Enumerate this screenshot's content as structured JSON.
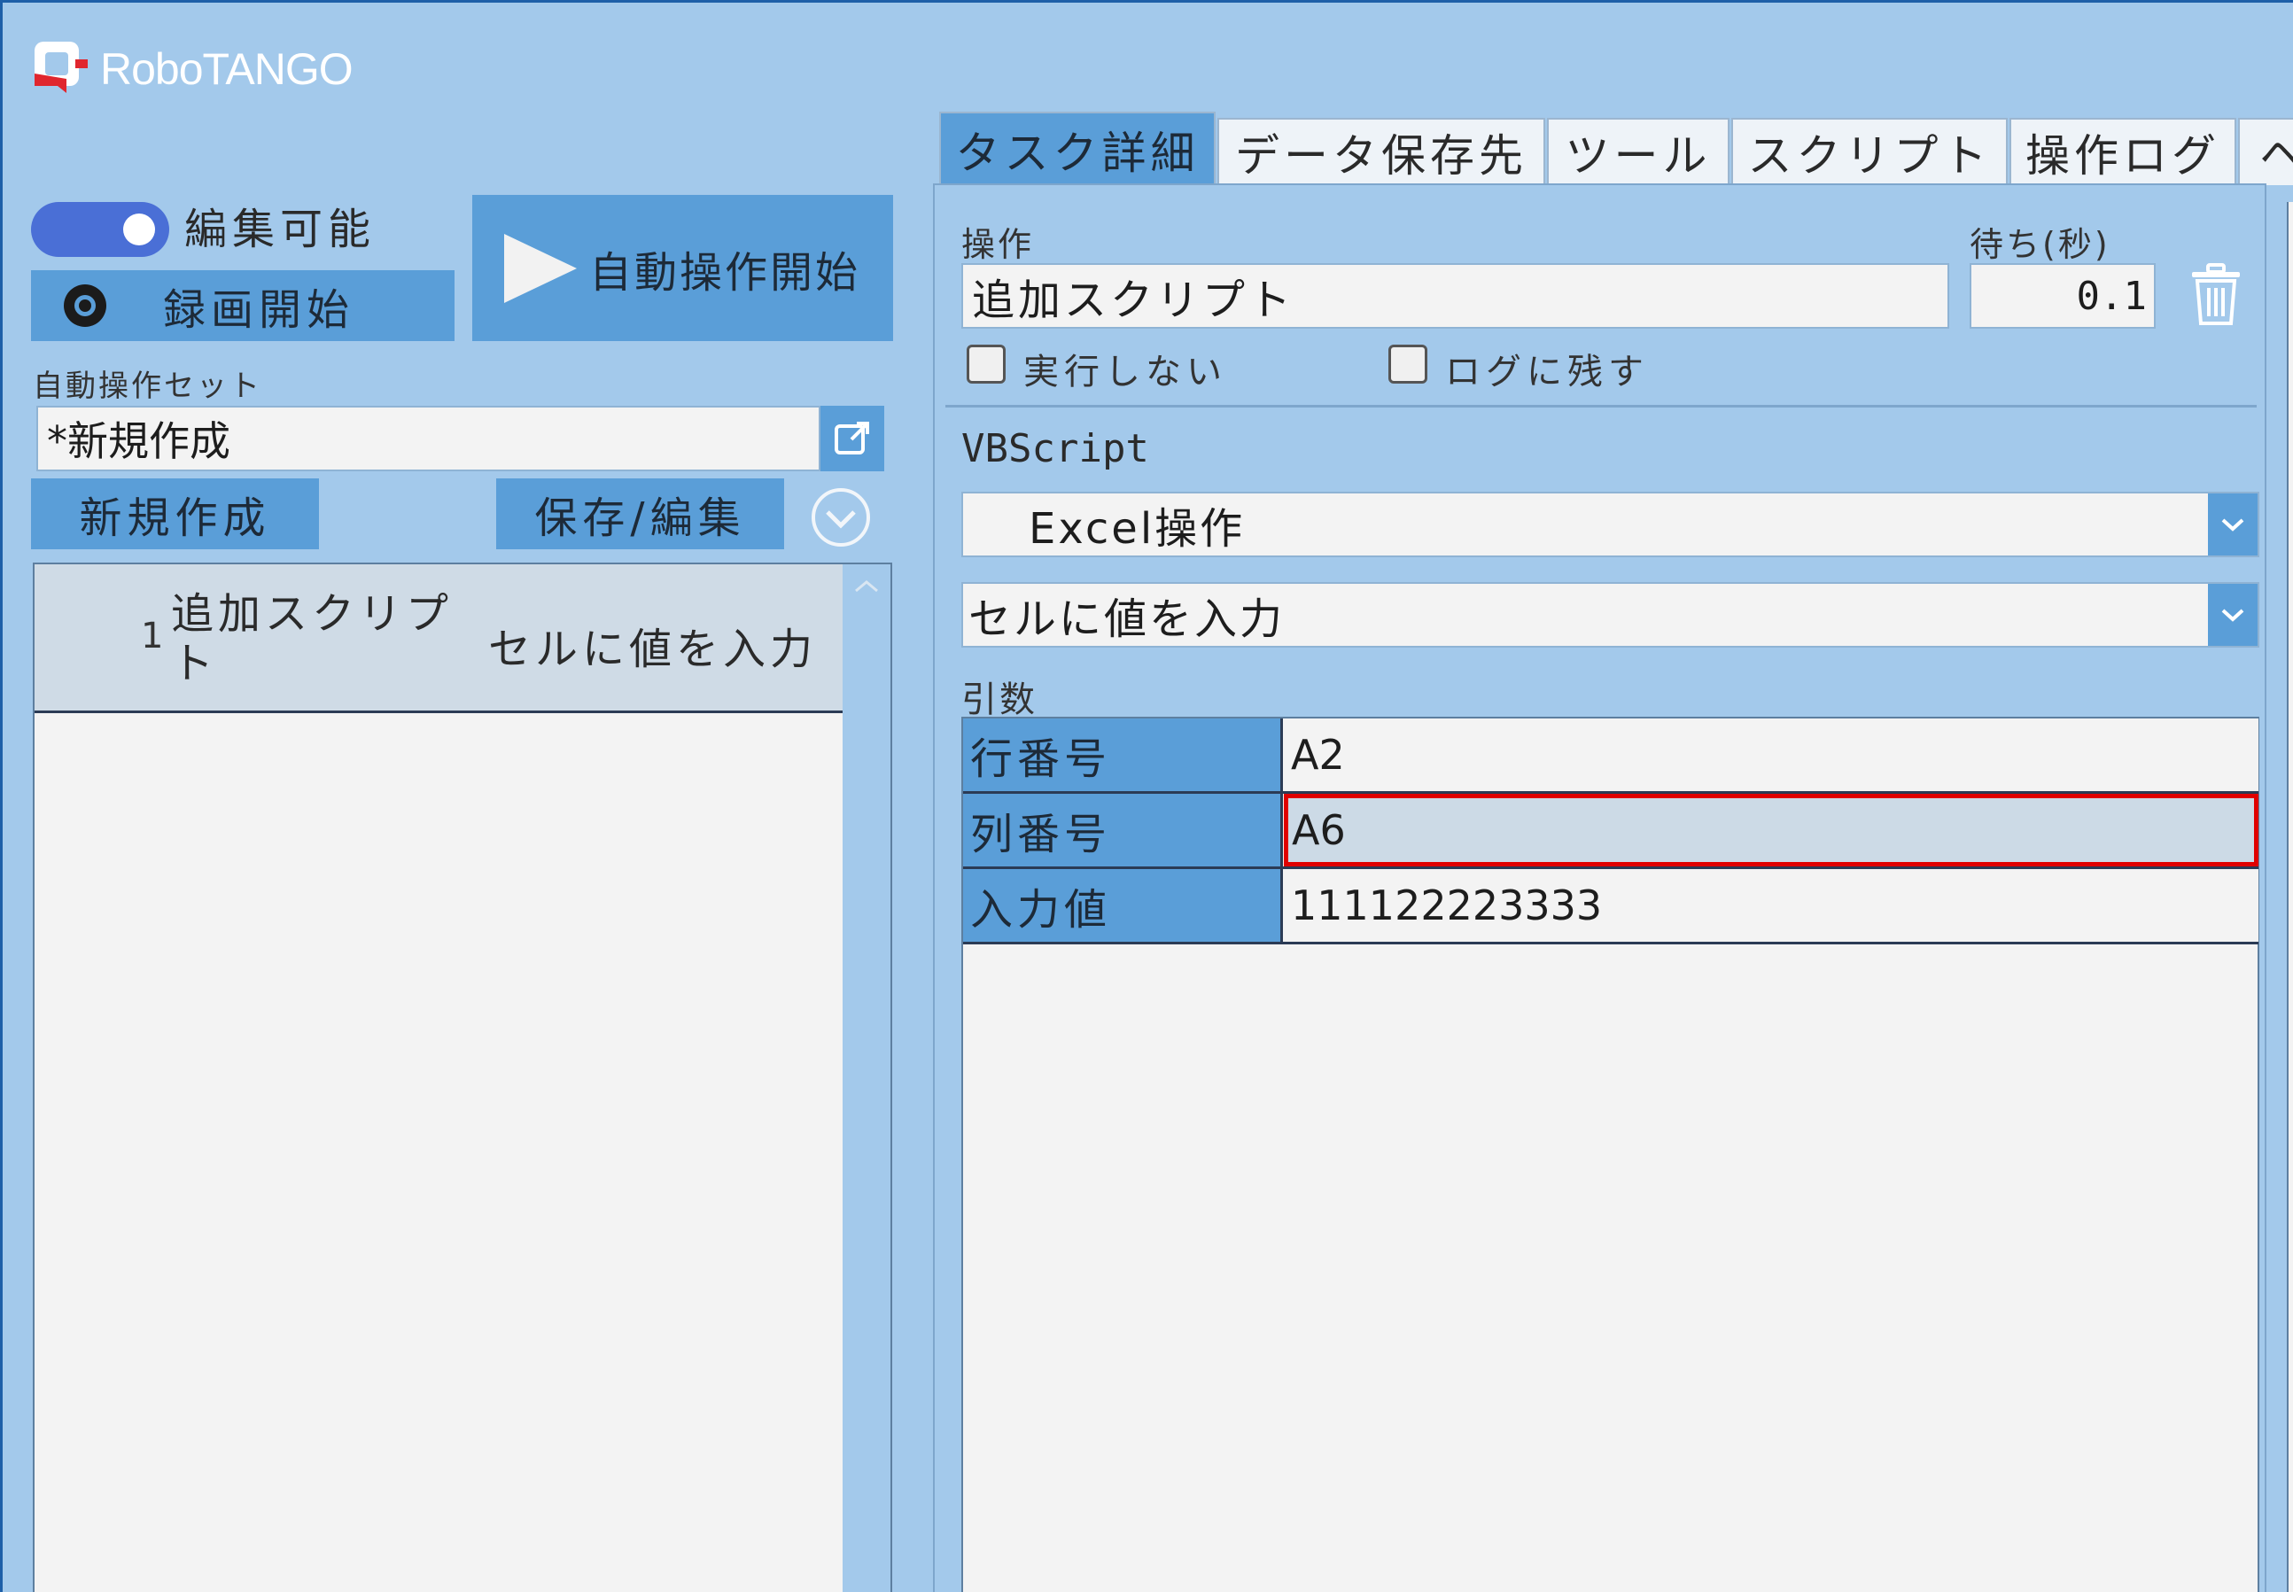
{
  "app": {
    "logo_text": "RoboTANGO"
  },
  "left": {
    "edit_toggle_label": "編集可能",
    "record_label": "録画開始",
    "auto_start_label": "自動操作開始",
    "set_label": "自動操作セット",
    "set_name": "*新規作成",
    "new_button": "新規作成",
    "save_button": "保存/編集",
    "list": [
      {
        "index": "1",
        "name_line1": "追加スクリプ",
        "name_line2": "ト",
        "action": "セルに値を入力"
      }
    ]
  },
  "tabs": [
    {
      "label": "タスク詳細",
      "active": true
    },
    {
      "label": "データ保存先",
      "active": false
    },
    {
      "label": "ツール",
      "active": false
    },
    {
      "label": "スクリプト",
      "active": false
    },
    {
      "label": "操作ログ",
      "active": false
    },
    {
      "label": "ヘ",
      "active": false
    }
  ],
  "detail": {
    "operation_label": "操作",
    "operation_value": "追加スクリプト",
    "wait_label": "待ち(秒)",
    "wait_value": "0.1",
    "no_exec_label": "実行しない",
    "log_label": "ログに残す",
    "script_label": "VBScript",
    "category_value": "Excel操作",
    "command_value": "セルに値を入力",
    "args_label": "引数",
    "args": [
      {
        "name": "行番号",
        "value": "A2"
      },
      {
        "name": "列番号",
        "value": "A6"
      },
      {
        "name": "入力値",
        "value": "111122223333"
      }
    ]
  },
  "colors": {
    "background": "#a3c9eb",
    "accent": "#5a9ed8",
    "toggle": "#4a6fd6",
    "highlight": "#e00000"
  }
}
